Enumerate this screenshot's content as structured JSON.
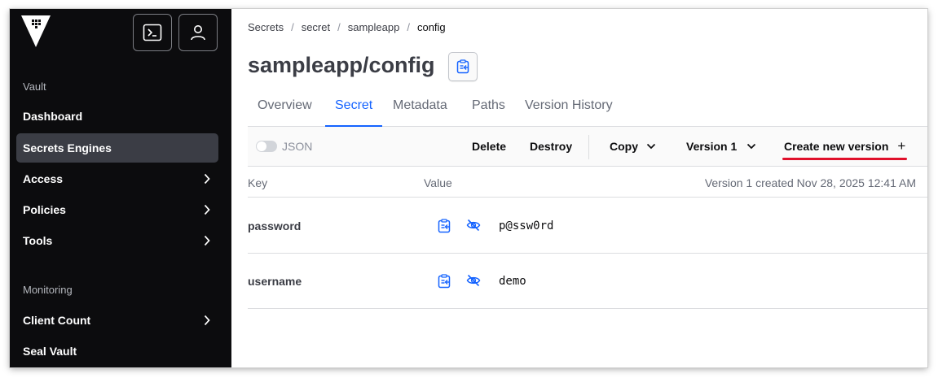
{
  "sidebar": {
    "logo_icon": "vault-logo-icon",
    "console_icon": "terminal-icon",
    "user_icon": "user-icon",
    "section_vault": "Vault",
    "items_vault": [
      {
        "label": "Dashboard",
        "has_chevron": false
      },
      {
        "label": "Secrets Engines",
        "has_chevron": false,
        "active": true
      },
      {
        "label": "Access",
        "has_chevron": true
      },
      {
        "label": "Policies",
        "has_chevron": true
      },
      {
        "label": "Tools",
        "has_chevron": true
      }
    ],
    "section_monitoring": "Monitoring",
    "items_monitoring": [
      {
        "label": "Client Count",
        "has_chevron": true
      },
      {
        "label": "Seal Vault",
        "has_chevron": false
      }
    ]
  },
  "breadcrumb": [
    "Secrets",
    "secret",
    "sampleapp",
    "config"
  ],
  "page_title": "sampleapp/config",
  "tabs": [
    "Overview",
    "Secret",
    "Metadata",
    "Paths",
    "Version History"
  ],
  "active_tab": "Secret",
  "toolbar": {
    "json_label": "JSON",
    "delete_label": "Delete",
    "destroy_label": "Destroy",
    "copy_label": "Copy",
    "version_label": "Version 1",
    "create_label": "Create new version",
    "create_icon": "+"
  },
  "table": {
    "header_key": "Key",
    "header_value": "Value",
    "version_info": "Version 1 created Nov 28, 2025 12:41 AM",
    "rows": [
      {
        "key": "password",
        "value": "p@ssw0rd"
      },
      {
        "key": "username",
        "value": "demo"
      }
    ]
  },
  "colors": {
    "sidebar_bg": "#0c0c0e",
    "active_nav_bg": "#3b3d45",
    "accent_blue": "#1563ff",
    "highlight_red": "#e0102b"
  }
}
